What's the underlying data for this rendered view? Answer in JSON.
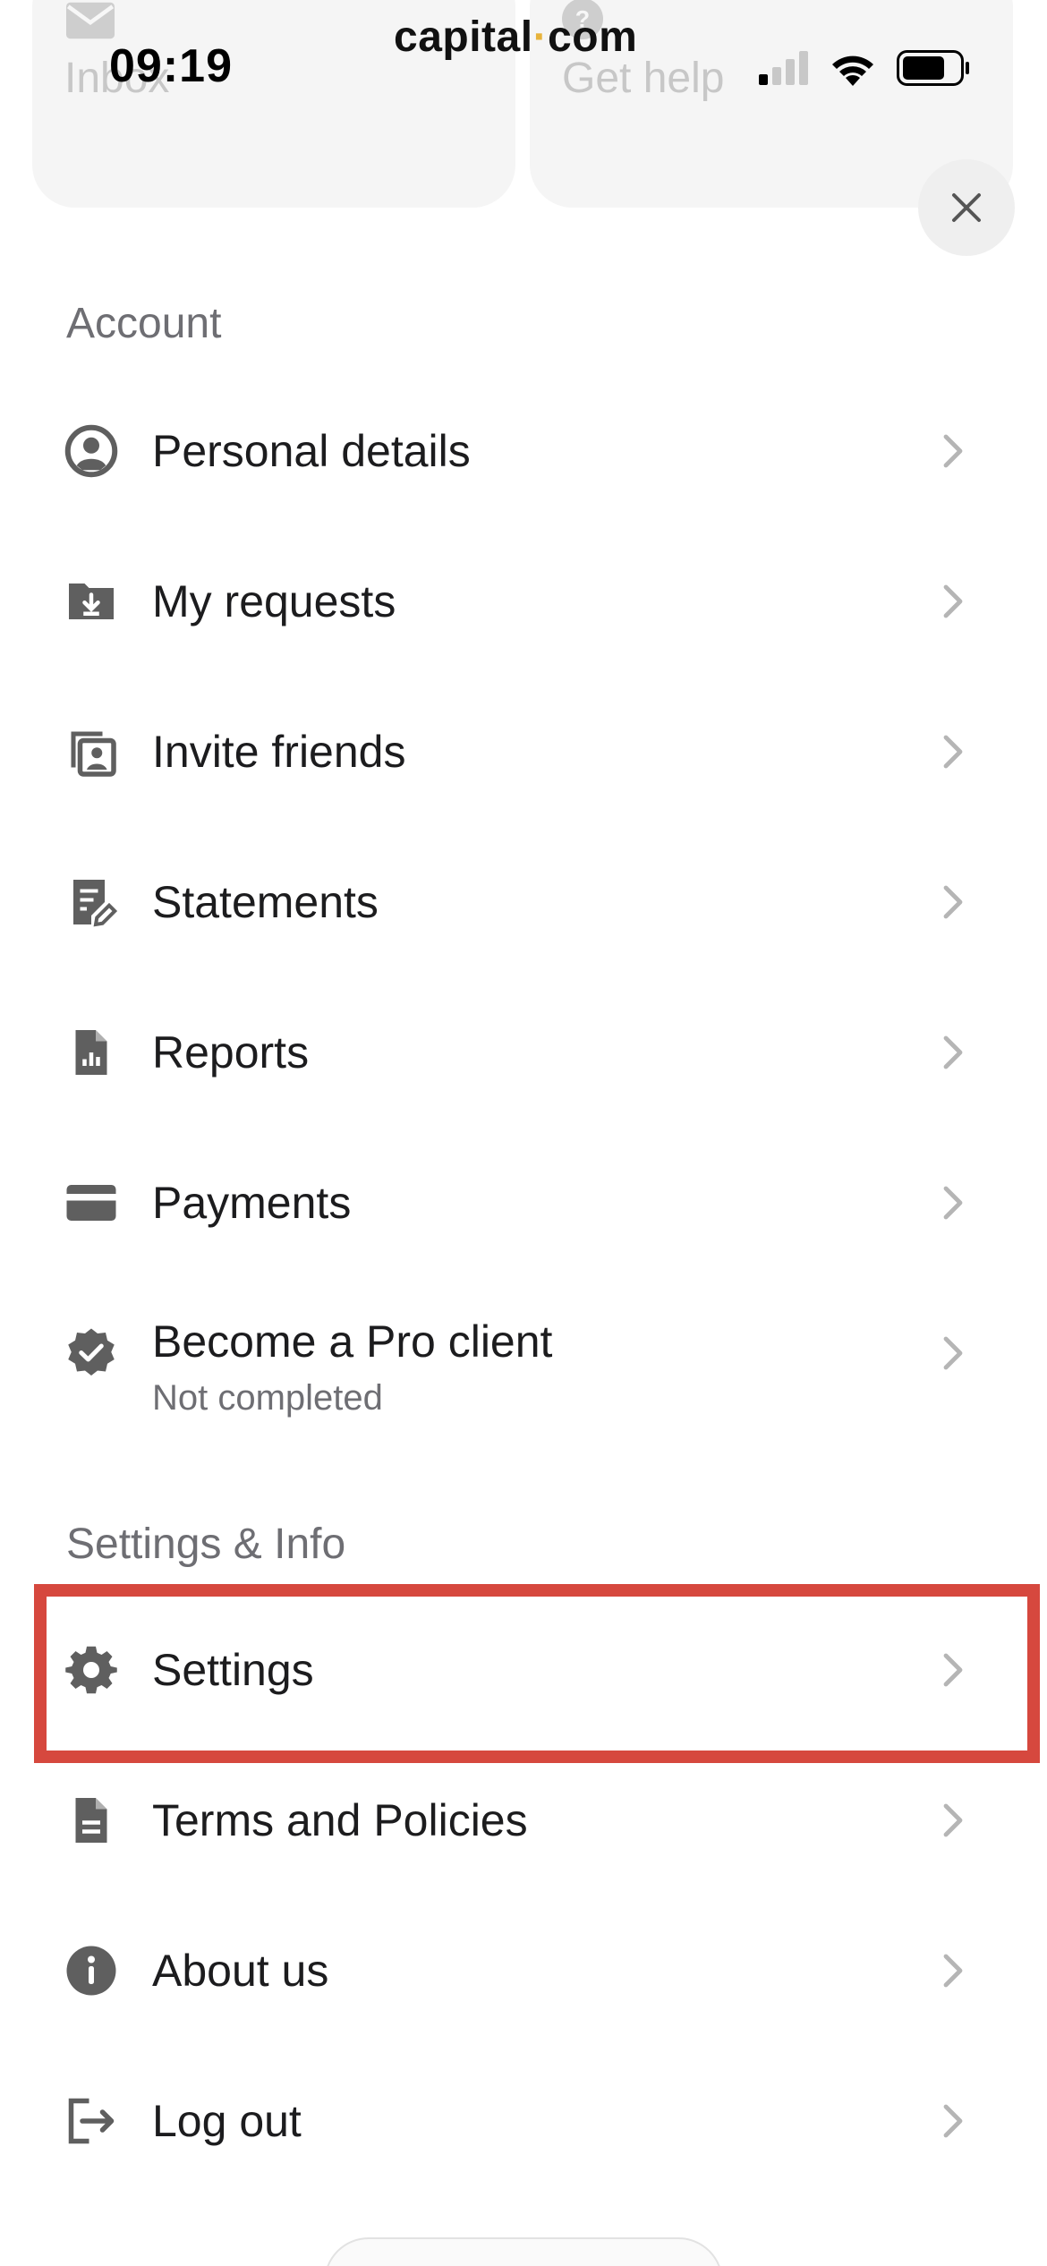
{
  "status_bar": {
    "time": "09:19",
    "brand_left": "capital",
    "brand_dot": "·",
    "brand_right": "com"
  },
  "quick_actions": [
    {
      "label": "Inbox",
      "icon": "envelope-icon"
    },
    {
      "label": "Get help",
      "icon": "help-icon"
    }
  ],
  "account": {
    "title": "Account",
    "items": [
      {
        "label": "Personal details",
        "icon": "user-circle-icon"
      },
      {
        "label": "My requests",
        "icon": "folder-download-icon"
      },
      {
        "label": "Invite friends",
        "icon": "invite-card-icon"
      },
      {
        "label": "Statements",
        "icon": "document-edit-icon"
      },
      {
        "label": "Reports",
        "icon": "report-file-icon"
      },
      {
        "label": "Payments",
        "icon": "credit-card-icon"
      },
      {
        "label": "Become a Pro client",
        "sublabel": "Not completed",
        "icon": "verified-badge-icon"
      }
    ]
  },
  "settings_info": {
    "title": "Settings & Info",
    "items": [
      {
        "label": "Settings",
        "icon": "gear-icon"
      },
      {
        "label": "Terms and Policies",
        "icon": "document-icon"
      },
      {
        "label": "About us",
        "icon": "info-icon"
      },
      {
        "label": "Log out",
        "icon": "logout-icon"
      }
    ]
  },
  "colors": {
    "icon": "#5f5f5f",
    "chevron": "#b5b5b5",
    "highlight": "#d6483e",
    "brand_dot": "#e7b33b"
  }
}
